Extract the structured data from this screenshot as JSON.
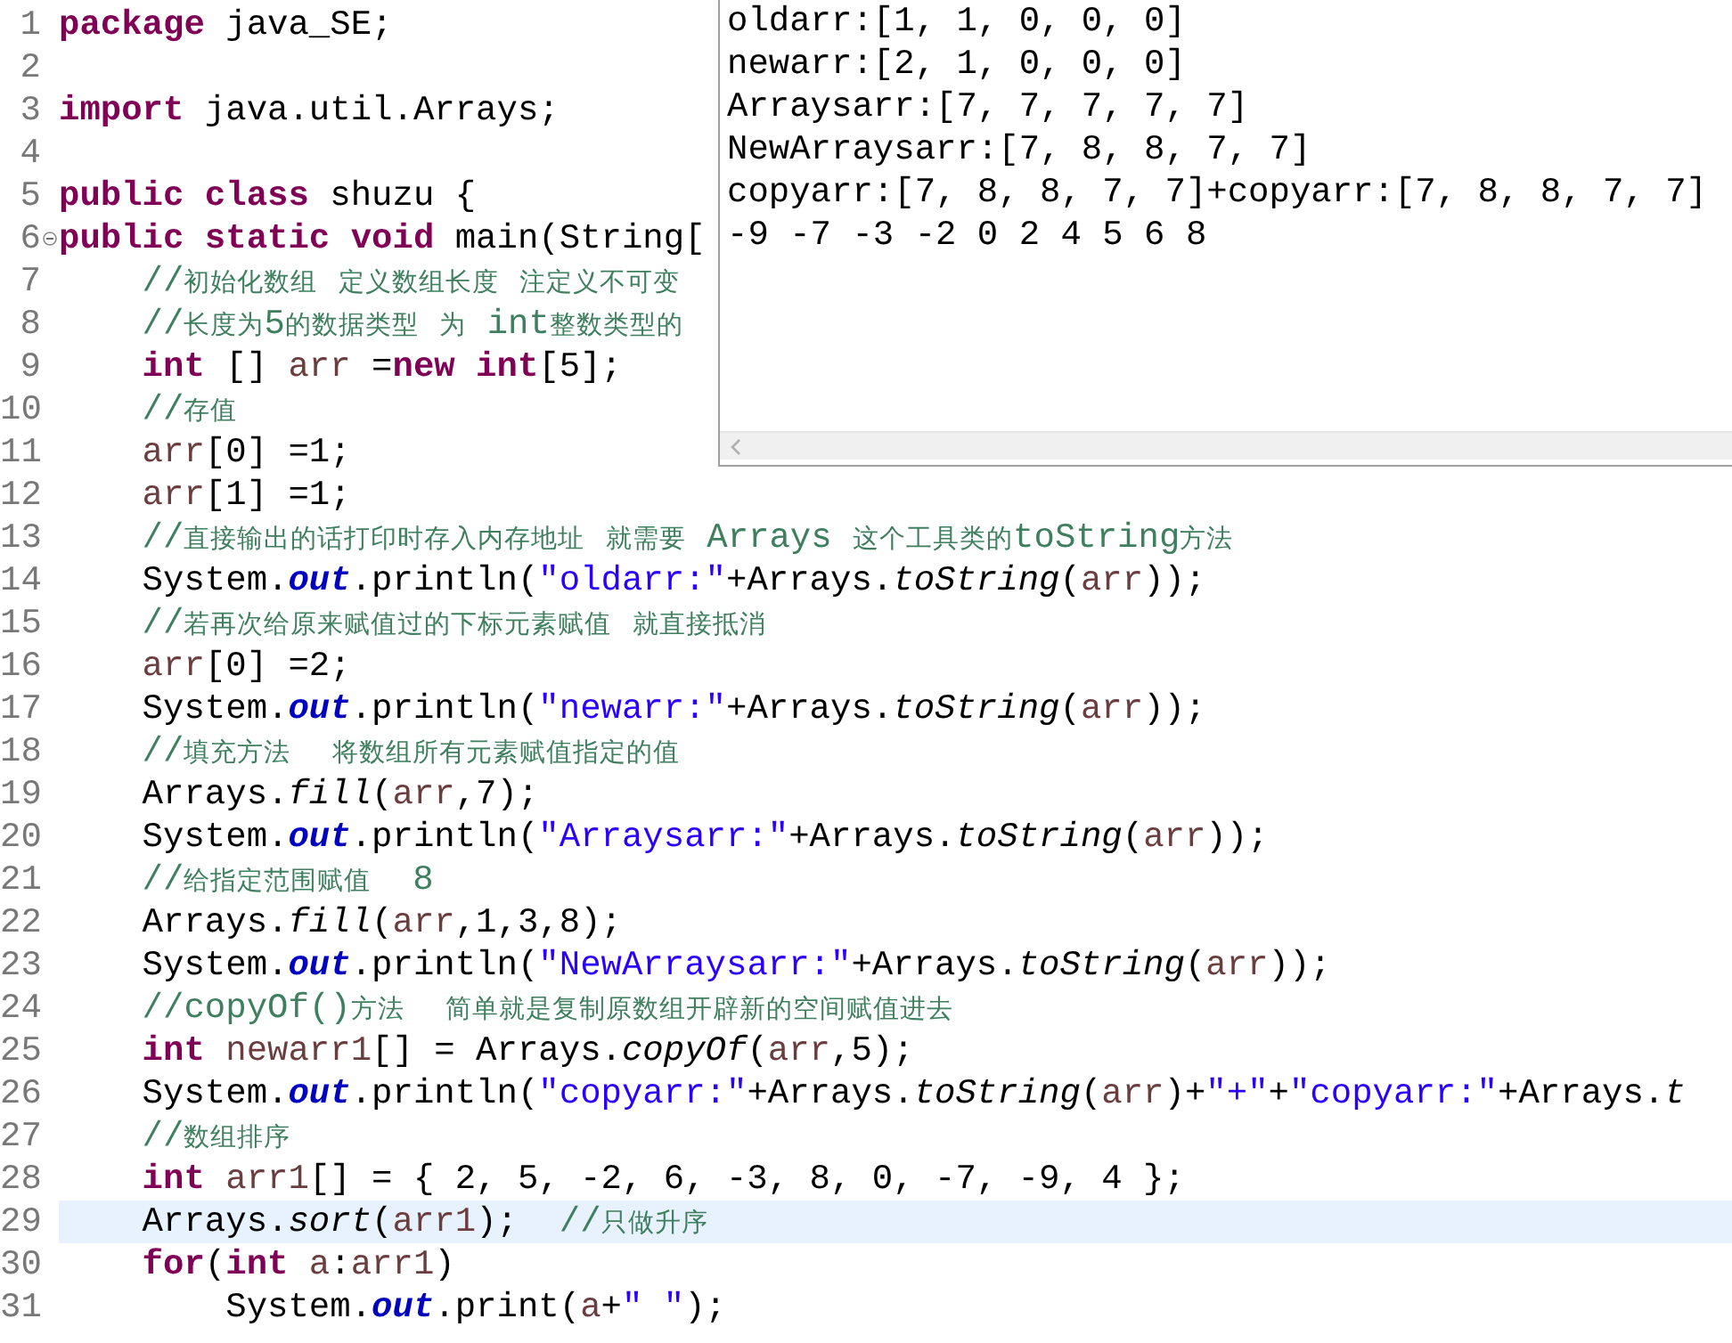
{
  "editor": {
    "lines": [
      {
        "number": "1",
        "current": false,
        "fold": false,
        "tokens": [
          {
            "kind": "keyword",
            "text": "package"
          },
          {
            "kind": "plain",
            "text": " java_SE;"
          }
        ]
      },
      {
        "number": "2",
        "current": false,
        "fold": false
      },
      {
        "number": "3",
        "current": false,
        "fold": false,
        "tokens": [
          {
            "kind": "keyword",
            "text": "import"
          },
          {
            "kind": "plain",
            "text": " java.util.Arrays;"
          }
        ]
      },
      {
        "number": "4",
        "current": false,
        "fold": false
      },
      {
        "number": "5",
        "current": false,
        "fold": false,
        "tokens": [
          {
            "kind": "keyword",
            "text": "public"
          },
          {
            "kind": "keyword",
            "text": " class"
          },
          {
            "kind": "plain",
            "text": " shuzu {"
          }
        ]
      },
      {
        "number": "6",
        "current": false,
        "fold": true,
        "tokens": [
          {
            "kind": "keyword",
            "text": "public"
          },
          {
            "kind": "keyword",
            "text": " static"
          },
          {
            "kind": "keyword",
            "text": " void"
          },
          {
            "kind": "plain",
            "text": " main(String["
          }
        ]
      },
      {
        "number": "7",
        "current": false,
        "fold": false,
        "tokens": [
          {
            "kind": "comment",
            "text": "    //初始化数组 定义数组长度 注定义不可变"
          }
        ]
      },
      {
        "number": "8",
        "current": false,
        "fold": false,
        "tokens": [
          {
            "kind": "comment",
            "text": "    //长度为5的数据类型 为 int整数类型的"
          }
        ]
      },
      {
        "number": "9",
        "current": false,
        "fold": false,
        "tokens": [
          {
            "kind": "keyword",
            "text": "    int"
          },
          {
            "kind": "plain",
            "text": " [] "
          },
          {
            "kind": "variable",
            "text": "arr"
          },
          {
            "kind": "plain",
            "text": " ="
          },
          {
            "kind": "keyword",
            "text": "new"
          },
          {
            "kind": "keyword",
            "text": " int"
          },
          {
            "kind": "plain",
            "text": "[5];"
          }
        ]
      },
      {
        "number": "10",
        "current": false,
        "fold": false,
        "tokens": [
          {
            "kind": "comment",
            "text": "    //存值"
          }
        ]
      },
      {
        "number": "11",
        "current": false,
        "fold": false,
        "tokens": [
          {
            "kind": "variable",
            "text": "    arr"
          },
          {
            "kind": "plain",
            "text": "[0] =1;"
          }
        ]
      },
      {
        "number": "12",
        "current": false,
        "fold": false,
        "tokens": [
          {
            "kind": "variable",
            "text": "    arr"
          },
          {
            "kind": "plain",
            "text": "[1] =1;"
          }
        ]
      },
      {
        "number": "13",
        "current": false,
        "fold": false,
        "tokens": [
          {
            "kind": "comment",
            "text": "    //直接输出的话打印时存入内存地址 就需要 Arrays 这个工具类的toString方法"
          }
        ]
      },
      {
        "number": "14",
        "current": false,
        "fold": false,
        "tokens": [
          {
            "kind": "plain",
            "text": "    System."
          },
          {
            "kind": "field",
            "text": "out"
          },
          {
            "kind": "plain",
            "text": ".println("
          },
          {
            "kind": "string",
            "text": "\"oldarr:\""
          },
          {
            "kind": "plain",
            "text": "+Arrays."
          },
          {
            "kind": "method",
            "text": "toString"
          },
          {
            "kind": "plain",
            "text": "("
          },
          {
            "kind": "variable",
            "text": "arr"
          },
          {
            "kind": "plain",
            "text": "));"
          }
        ]
      },
      {
        "number": "15",
        "current": false,
        "fold": false,
        "tokens": [
          {
            "kind": "comment",
            "text": "    //若再次给原来赋值过的下标元素赋值 就直接抵消"
          }
        ]
      },
      {
        "number": "16",
        "current": false,
        "fold": false,
        "tokens": [
          {
            "kind": "variable",
            "text": "    arr"
          },
          {
            "kind": "plain",
            "text": "[0] =2;"
          }
        ]
      },
      {
        "number": "17",
        "current": false,
        "fold": false,
        "tokens": [
          {
            "kind": "plain",
            "text": "    System."
          },
          {
            "kind": "field",
            "text": "out"
          },
          {
            "kind": "plain",
            "text": ".println("
          },
          {
            "kind": "string",
            "text": "\"newarr:\""
          },
          {
            "kind": "plain",
            "text": "+Arrays."
          },
          {
            "kind": "method",
            "text": "toString"
          },
          {
            "kind": "plain",
            "text": "("
          },
          {
            "kind": "variable",
            "text": "arr"
          },
          {
            "kind": "plain",
            "text": "));"
          }
        ]
      },
      {
        "number": "18",
        "current": false,
        "fold": false,
        "tokens": [
          {
            "kind": "comment",
            "text": "    //填充方法  将数组所有元素赋值指定的值"
          }
        ]
      },
      {
        "number": "19",
        "current": false,
        "fold": false,
        "tokens": [
          {
            "kind": "plain",
            "text": "    Arrays."
          },
          {
            "kind": "method",
            "text": "fill"
          },
          {
            "kind": "plain",
            "text": "("
          },
          {
            "kind": "variable",
            "text": "arr"
          },
          {
            "kind": "plain",
            "text": ",7);"
          }
        ]
      },
      {
        "number": "20",
        "current": false,
        "fold": false,
        "tokens": [
          {
            "kind": "plain",
            "text": "    System."
          },
          {
            "kind": "field",
            "text": "out"
          },
          {
            "kind": "plain",
            "text": ".println("
          },
          {
            "kind": "string",
            "text": "\"Arraysarr:\""
          },
          {
            "kind": "plain",
            "text": "+Arrays."
          },
          {
            "kind": "method",
            "text": "toString"
          },
          {
            "kind": "plain",
            "text": "("
          },
          {
            "kind": "variable",
            "text": "arr"
          },
          {
            "kind": "plain",
            "text": "));"
          }
        ]
      },
      {
        "number": "21",
        "current": false,
        "fold": false,
        "tokens": [
          {
            "kind": "comment",
            "text": "    //给指定范围赋值  8"
          }
        ]
      },
      {
        "number": "22",
        "current": false,
        "fold": false,
        "tokens": [
          {
            "kind": "plain",
            "text": "    Arrays."
          },
          {
            "kind": "method",
            "text": "fill"
          },
          {
            "kind": "plain",
            "text": "("
          },
          {
            "kind": "variable",
            "text": "arr"
          },
          {
            "kind": "plain",
            "text": ",1,3,8);"
          }
        ]
      },
      {
        "number": "23",
        "current": false,
        "fold": false,
        "tokens": [
          {
            "kind": "plain",
            "text": "    System."
          },
          {
            "kind": "field",
            "text": "out"
          },
          {
            "kind": "plain",
            "text": ".println("
          },
          {
            "kind": "string",
            "text": "\"NewArraysarr:\""
          },
          {
            "kind": "plain",
            "text": "+Arrays."
          },
          {
            "kind": "method",
            "text": "toString"
          },
          {
            "kind": "plain",
            "text": "("
          },
          {
            "kind": "variable",
            "text": "arr"
          },
          {
            "kind": "plain",
            "text": "));"
          }
        ]
      },
      {
        "number": "24",
        "current": false,
        "fold": false,
        "tokens": [
          {
            "kind": "comment",
            "text": "    //copyOf()方法  简单就是复制原数组开辟新的空间赋值进去"
          }
        ]
      },
      {
        "number": "25",
        "current": false,
        "fold": false,
        "tokens": [
          {
            "kind": "keyword",
            "text": "    int"
          },
          {
            "kind": "variable",
            "text": " newarr1"
          },
          {
            "kind": "plain",
            "text": "[] = Arrays."
          },
          {
            "kind": "method",
            "text": "copyOf"
          },
          {
            "kind": "plain",
            "text": "("
          },
          {
            "kind": "variable",
            "text": "arr"
          },
          {
            "kind": "plain",
            "text": ",5);"
          }
        ]
      },
      {
        "number": "26",
        "current": false,
        "fold": false,
        "tokens": [
          {
            "kind": "plain",
            "text": "    System."
          },
          {
            "kind": "field",
            "text": "out"
          },
          {
            "kind": "plain",
            "text": ".println("
          },
          {
            "kind": "string",
            "text": "\"copyarr:\""
          },
          {
            "kind": "plain",
            "text": "+Arrays."
          },
          {
            "kind": "method",
            "text": "toString"
          },
          {
            "kind": "plain",
            "text": "("
          },
          {
            "kind": "variable",
            "text": "arr"
          },
          {
            "kind": "plain",
            "text": ")+"
          },
          {
            "kind": "string",
            "text": "\"+\""
          },
          {
            "kind": "plain",
            "text": "+"
          },
          {
            "kind": "string",
            "text": "\"copyarr:\""
          },
          {
            "kind": "plain",
            "text": "+Arrays."
          },
          {
            "kind": "method",
            "text": "t"
          }
        ]
      },
      {
        "number": "27",
        "current": false,
        "fold": false,
        "tokens": [
          {
            "kind": "comment",
            "text": "    //数组排序"
          }
        ]
      },
      {
        "number": "28",
        "current": false,
        "fold": false,
        "tokens": [
          {
            "kind": "keyword",
            "text": "    int"
          },
          {
            "kind": "variable",
            "text": " arr1"
          },
          {
            "kind": "plain",
            "text": "[] = { 2, 5, -2, 6, -3, 8, 0, -7, -9, 4 };"
          }
        ]
      },
      {
        "number": "29",
        "current": true,
        "fold": false,
        "tokens": [
          {
            "kind": "plain",
            "text": "    Arrays."
          },
          {
            "kind": "method",
            "text": "sort"
          },
          {
            "kind": "plain",
            "text": "("
          },
          {
            "kind": "variable",
            "text": "arr1"
          },
          {
            "kind": "plain",
            "text": ");"
          },
          {
            "kind": "comment",
            "text": "  //只做升序"
          }
        ]
      },
      {
        "number": "30",
        "current": false,
        "fold": false,
        "tokens": [
          {
            "kind": "keyword",
            "text": "    for"
          },
          {
            "kind": "plain",
            "text": "("
          },
          {
            "kind": "keyword",
            "text": "int"
          },
          {
            "kind": "variable",
            "text": " a"
          },
          {
            "kind": "plain",
            "text": ":"
          },
          {
            "kind": "variable",
            "text": "arr1"
          },
          {
            "kind": "plain",
            "text": ")"
          }
        ]
      },
      {
        "number": "31",
        "current": false,
        "fold": false,
        "tokens": [
          {
            "kind": "plain",
            "text": "        System."
          },
          {
            "kind": "field",
            "text": "out"
          },
          {
            "kind": "plain",
            "text": ".print("
          },
          {
            "kind": "variable",
            "text": "a"
          },
          {
            "kind": "plain",
            "text": "+"
          },
          {
            "kind": "string",
            "text": "\" \""
          },
          {
            "kind": "plain",
            "text": ");"
          }
        ]
      }
    ]
  },
  "console": {
    "lines": [
      "oldarr:[1, 1, 0, 0, 0]",
      "newarr:[2, 1, 0, 0, 0]",
      "Arraysarr:[7, 7, 7, 7, 7]",
      "NewArraysarr:[7, 8, 8, 7, 7]",
      "copyarr:[7, 8, 8, 7, 7]+copyarr:[7, 8, 8, 7, 7]",
      "-9 -7 -3 -2 0 2 4 5 6 8"
    ]
  }
}
